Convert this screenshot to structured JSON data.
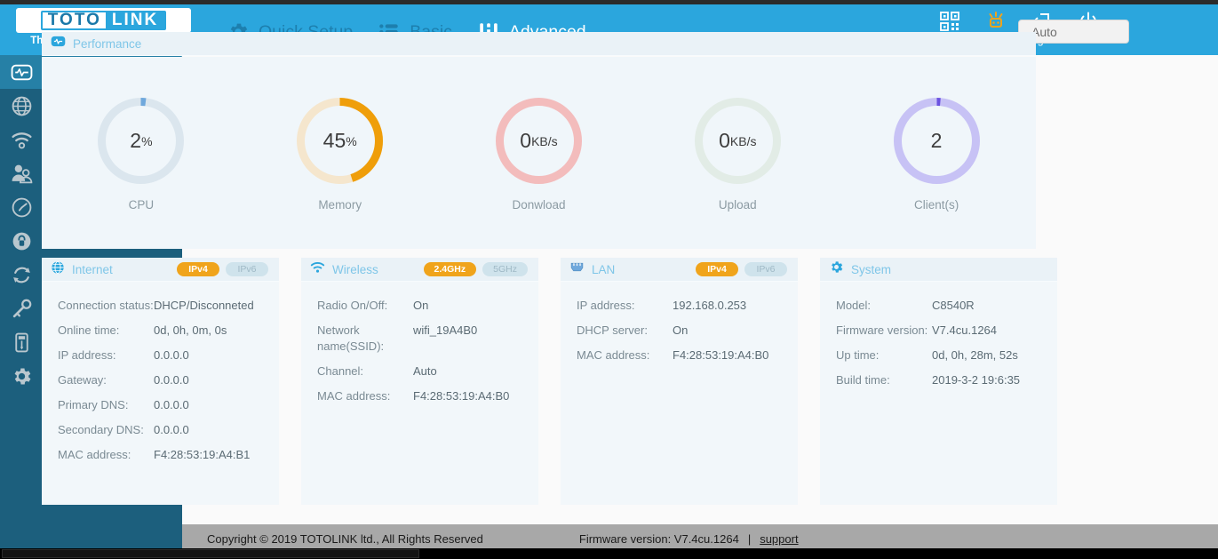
{
  "brand": {
    "logo_first": "TOTO",
    "logo_second": "LINK",
    "tagline": "The Smartest Network Device"
  },
  "header": {
    "nav": [
      {
        "label": "Quick Setup",
        "icon": "gear-icon",
        "active": false
      },
      {
        "label": "Basic",
        "icon": "list-icon",
        "active": false
      },
      {
        "label": "Advanced",
        "icon": "sliders-icon",
        "active": true
      }
    ],
    "actions": [
      {
        "label": "QR Code",
        "icon": "qr-code-icon",
        "color": "#ffffff"
      },
      {
        "label": "LED",
        "icon": "led-icon",
        "color": "#f0a41b"
      },
      {
        "label": "Logout",
        "icon": "logout-icon",
        "color": "#ffffff"
      },
      {
        "label": "Reboot",
        "icon": "power-icon",
        "color": "#ffffff"
      }
    ],
    "language_select": {
      "value": "Auto",
      "placeholder": "Auto"
    }
  },
  "sidebar": {
    "items": [
      {
        "label": "Home",
        "icon": "pulse-icon",
        "active": true
      },
      {
        "label": "Network",
        "icon": "globe-icon",
        "active": false
      },
      {
        "label": "Wireless",
        "icon": "wifi-icon",
        "active": false
      },
      {
        "label": "Parental Control",
        "icon": "users-icon",
        "active": false
      },
      {
        "label": "Smart QoS",
        "icon": "gauge-icon",
        "active": false
      },
      {
        "label": "Security",
        "icon": "lock-icon",
        "active": false
      },
      {
        "label": "NAT",
        "icon": "refresh-icon",
        "active": false
      },
      {
        "label": "VPN Server",
        "icon": "key-icon",
        "active": false
      },
      {
        "label": "Storage",
        "icon": "usb-icon",
        "active": false
      },
      {
        "label": "Tools",
        "icon": "gear-icon",
        "active": false
      }
    ]
  },
  "performance": {
    "title": "Performance",
    "icon": "pulse-badge-icon",
    "gauges": [
      {
        "label": "CPU",
        "value": "2",
        "unit": "%",
        "percent": 2,
        "color": "#6fa8dc",
        "track": "#dbe6ee"
      },
      {
        "label": "Memory",
        "value": "45",
        "unit": "%",
        "percent": 45,
        "color": "#ef9e0a",
        "track": "#f5e6cd"
      },
      {
        "label": "Donwload",
        "value": "0",
        "unit": "KB/s",
        "percent": 0,
        "color": "#f3bcbc",
        "track": "#f3bcbc"
      },
      {
        "label": "Upload",
        "value": "0",
        "unit": "KB/s",
        "percent": 0,
        "color": "#e2ece6",
        "track": "#e2ece6"
      },
      {
        "label": "Client(s)",
        "value": "2",
        "unit": "",
        "percent": 2,
        "color": "#6b52e0",
        "track": "#c7c2f5"
      }
    ]
  },
  "panels": [
    {
      "title": "Internet",
      "icon": "globe-icon",
      "badges": [
        {
          "label": "IPv4",
          "active": true
        },
        {
          "label": "IPv6",
          "active": false
        }
      ],
      "rows": [
        {
          "key": "Connection status:",
          "value": "DHCP/Disconneted"
        },
        {
          "key": "Online time:",
          "value": "0d, 0h, 0m, 0s"
        },
        {
          "key": "IP address:",
          "value": "0.0.0.0"
        },
        {
          "key": "Gateway:",
          "value": "0.0.0.0"
        },
        {
          "key": "Primary DNS:",
          "value": "0.0.0.0"
        },
        {
          "key": "Secondary DNS:",
          "value": "0.0.0.0"
        },
        {
          "key": "MAC address:",
          "value": "F4:28:53:19:A4:B1"
        }
      ]
    },
    {
      "title": "Wireless",
      "icon": "wifi-icon",
      "badges": [
        {
          "label": "2.4GHz",
          "active": true
        },
        {
          "label": "5GHz",
          "active": false
        }
      ],
      "rows": [
        {
          "key": "Radio On/Off:",
          "value": "On"
        },
        {
          "key": "Network name(SSID):",
          "value": "wifi_19A4B0"
        },
        {
          "key": "Channel:",
          "value": "Auto"
        },
        {
          "key": "MAC address:",
          "value": "F4:28:53:19:A4:B0"
        }
      ]
    },
    {
      "title": "LAN",
      "icon": "lan-port-icon",
      "badges": [
        {
          "label": "IPv4",
          "active": true
        },
        {
          "label": "IPv6",
          "active": false
        }
      ],
      "rows": [
        {
          "key": "IP address:",
          "value": "192.168.0.253"
        },
        {
          "key": "DHCP server:",
          "value": "On"
        },
        {
          "key": "MAC address:",
          "value": "F4:28:53:19:A4:B0"
        }
      ]
    },
    {
      "title": "System",
      "icon": "gear-icon",
      "badges": [],
      "rows": [
        {
          "key": "Model:",
          "value": "C8540R"
        },
        {
          "key": "Firmware version:",
          "value": "V7.4cu.1264"
        },
        {
          "key": "Up time:",
          "value": "0d, 0h, 28m, 52s"
        },
        {
          "key": "Build time:",
          "value": "2019-3-2 19:6:35"
        }
      ]
    }
  ],
  "footer": {
    "copyright": "Copyright © 2019 TOTOLINK ltd., All Rights Reserved",
    "firmware": "Firmware version: V7.4cu.1264",
    "separator": "|",
    "support": "support"
  },
  "colors": {
    "header_blue": "#2ba6dd",
    "sidebar_blue": "#1c5f7d",
    "sidebar_active": "#2680a6",
    "accent_orange": "#f0a41b",
    "panel_bg": "#f0f6fa"
  }
}
